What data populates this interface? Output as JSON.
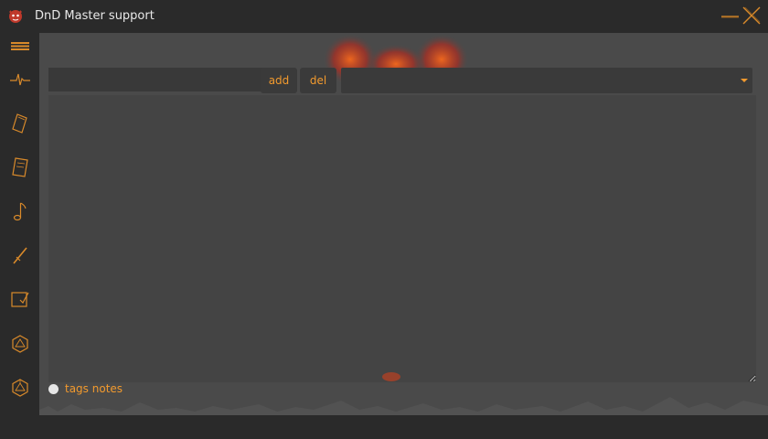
{
  "window": {
    "title": "DnD Master support",
    "icons": {
      "app": "red-dragon-icon",
      "minimize": "minimize-icon",
      "close": "close-icon"
    }
  },
  "sidebar": {
    "items": [
      {
        "name": "menu-icon"
      },
      {
        "name": "pulse-icon"
      },
      {
        "name": "card-icon"
      },
      {
        "name": "scroll-icon"
      },
      {
        "name": "music-note-icon"
      },
      {
        "name": "sword-icon"
      },
      {
        "name": "notes-edit-icon"
      },
      {
        "name": "d20-icon"
      },
      {
        "name": "d20-alt-icon"
      }
    ]
  },
  "toolbar": {
    "name_value": "",
    "add_label": "add",
    "del_label": "del",
    "select_value": ""
  },
  "notes": {
    "value": ""
  },
  "footer": {
    "tags_label": "tags notes"
  },
  "colors": {
    "accent": "#f29a2e",
    "background": "#2a2a2a",
    "panel": "#4a4a4a"
  }
}
